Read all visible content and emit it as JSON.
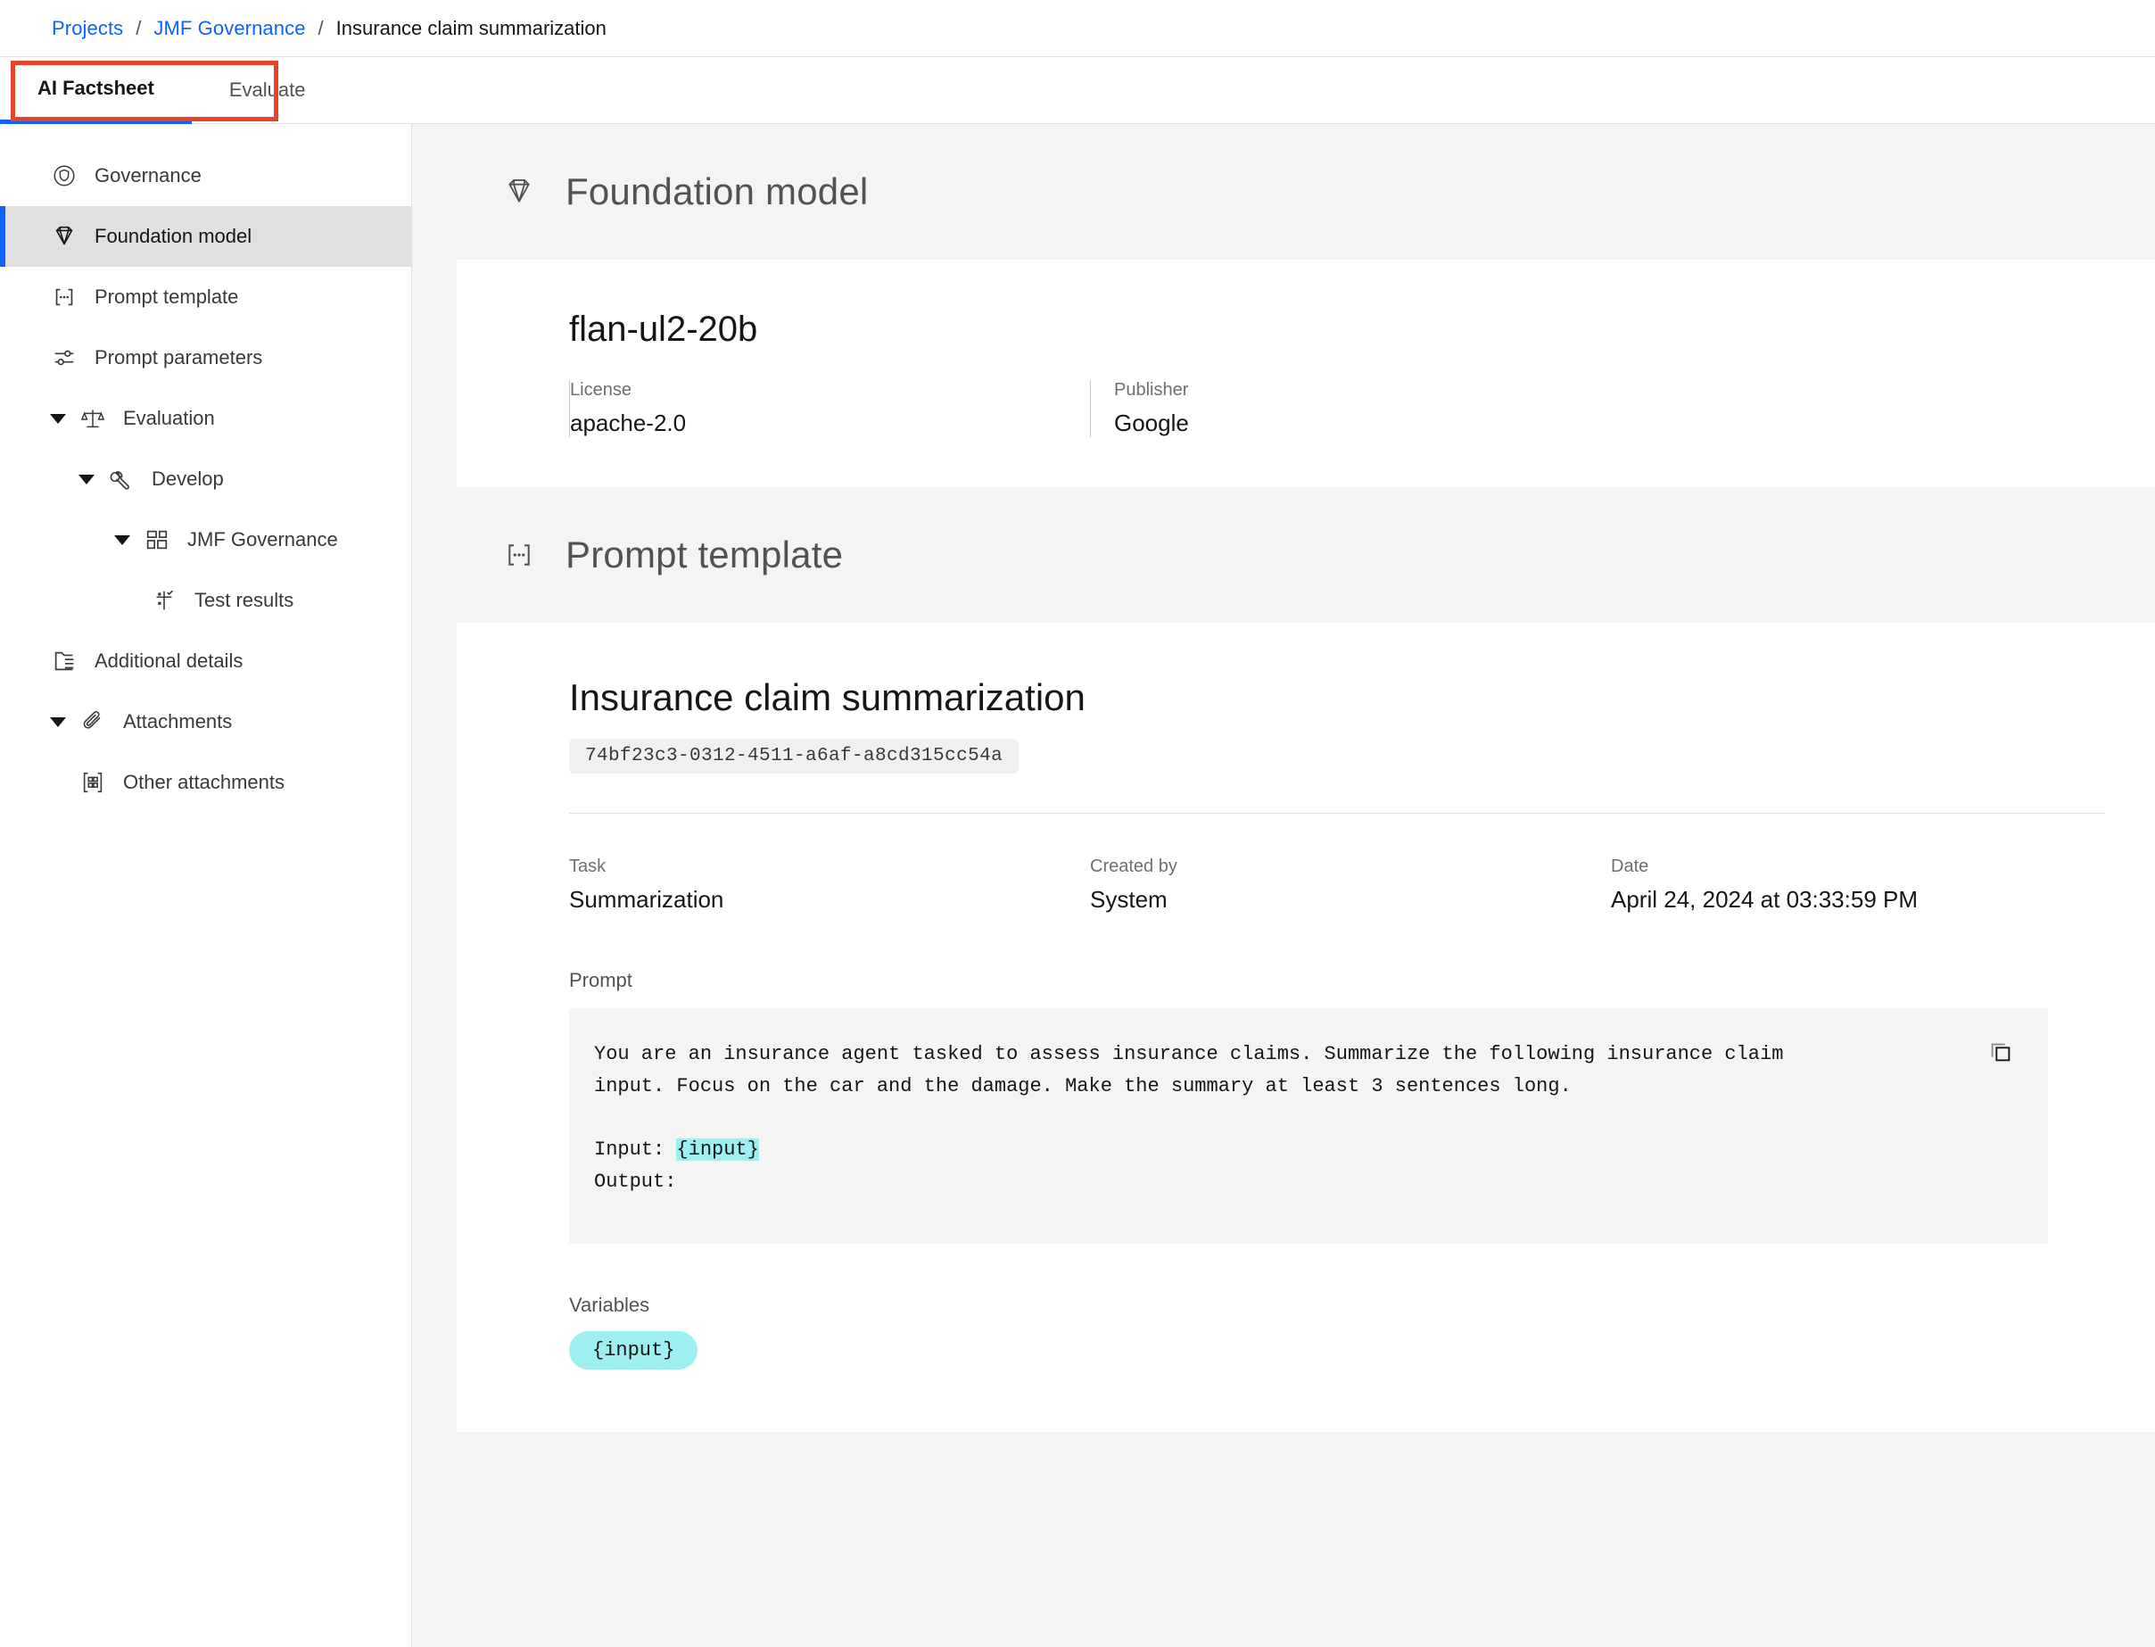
{
  "breadcrumb": {
    "items": [
      {
        "label": "Projects",
        "link": true
      },
      {
        "label": "JMF Governance",
        "link": true
      },
      {
        "label": "Insurance claim summarization",
        "link": false
      }
    ],
    "separator": "/"
  },
  "tabs": [
    {
      "label": "AI Factsheet",
      "active": true
    },
    {
      "label": "Evaluate",
      "active": false
    }
  ],
  "sidebar": {
    "items": [
      {
        "label": "Governance",
        "icon": "governance-icon",
        "level": 1,
        "selected": false,
        "caret": false
      },
      {
        "label": "Foundation model",
        "icon": "gem-icon",
        "level": 1,
        "selected": true,
        "caret": false
      },
      {
        "label": "Prompt template",
        "icon": "prompt-template-icon",
        "level": 1,
        "selected": false,
        "caret": false
      },
      {
        "label": "Prompt parameters",
        "icon": "sliders-icon",
        "level": 1,
        "selected": false,
        "caret": false
      },
      {
        "label": "Evaluation",
        "icon": "scales-icon",
        "level": 1,
        "selected": false,
        "caret": true
      },
      {
        "label": "Develop",
        "icon": "wrench-icon",
        "level": 2,
        "selected": false,
        "caret": true
      },
      {
        "label": "JMF Governance",
        "icon": "dashboard-icon",
        "level": 3,
        "selected": false,
        "caret": true
      },
      {
        "label": "Test results",
        "icon": "test-results-icon",
        "level": 4,
        "selected": false,
        "caret": false
      },
      {
        "label": "Additional details",
        "icon": "folder-details-icon",
        "level": 1,
        "selected": false,
        "caret": false
      },
      {
        "label": "Attachments",
        "icon": "paperclip-icon",
        "level": 1,
        "selected": false,
        "caret": true
      },
      {
        "label": "Other attachments",
        "icon": "grid-attachment-icon",
        "level": 2,
        "selected": false,
        "caret": false
      }
    ]
  },
  "foundation_model": {
    "section_title": "Foundation model",
    "section_icon": "gem-icon",
    "model_name": "flan-ul2-20b",
    "fields": [
      {
        "label": "License",
        "value": "apache-2.0"
      },
      {
        "label": "Publisher",
        "value": "Google"
      }
    ]
  },
  "prompt_template": {
    "section_title": "Prompt template",
    "section_icon": "prompt-template-icon",
    "title": "Insurance claim summarization",
    "uuid": "74bf23c3-0312-4511-a6af-a8cd315cc54a",
    "meta": [
      {
        "label": "Task",
        "value": "Summarization"
      },
      {
        "label": "Created by",
        "value": "System"
      },
      {
        "label": "Date",
        "value": "April 24, 2024 at 03:33:59 PM"
      }
    ],
    "prompt_label": "Prompt",
    "prompt_body_before": "You are an insurance agent tasked to assess insurance claims. Summarize the following insurance claim input. Focus on the car and the damage. Make the summary at least 3 sentences long.\n\nInput: ",
    "prompt_variable": "{input}",
    "prompt_body_after": "\nOutput:",
    "copy_icon": "copy-icon",
    "variables_label": "Variables",
    "variables": [
      "{input}"
    ]
  },
  "colors": {
    "link": "#0f62fe",
    "accent_bar": "#0f62fe",
    "highlight_box": "#e8432a",
    "variable_highlight": "#9ef0f0",
    "selected_nav": "#e0e0e0",
    "section_bg": "#f4f4f4"
  }
}
